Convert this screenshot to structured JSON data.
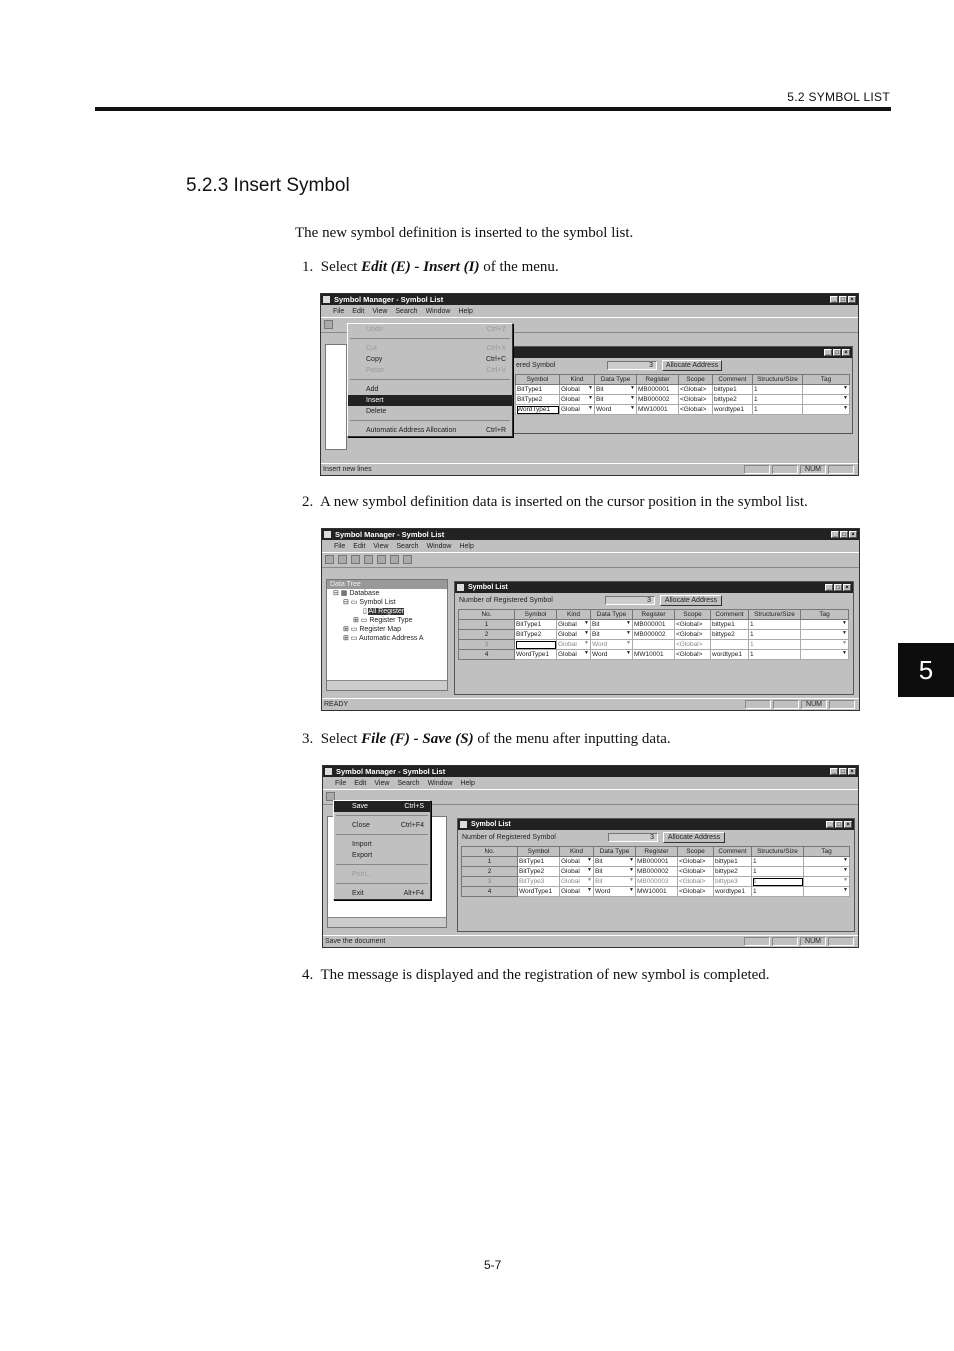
{
  "header": {
    "section": "5.2  SYMBOL LIST"
  },
  "section_title": "5.2.3  Insert Symbol",
  "intro": "The new symbol definition is inserted to the symbol list.",
  "steps": [
    {
      "num": "1.",
      "pre": "Select ",
      "bold": "Edit (E) - Insert (I)",
      "post": " of the menu."
    },
    {
      "num": "2.",
      "text": "A new symbol definition data is inserted on the cursor position in the symbol list."
    },
    {
      "num": "3.",
      "pre": "Select ",
      "bold": "File (F) - Save (S)",
      "post": " of the menu after inputting data."
    },
    {
      "num": "4.",
      "text": "The message is displayed and the registration of new symbol is completed."
    }
  ],
  "chapter_tab": "5",
  "page_number": "5-7",
  "app": {
    "title": "Symbol Manager - Symbol List",
    "menubar": [
      "File",
      "Edit",
      "View",
      "Search",
      "Window",
      "Help"
    ],
    "child_title": "Symbol List",
    "registered_label": "Number of Registered Symbol",
    "registered_label_short": "ered Symbol",
    "registered_value": "3",
    "alloc_button": "Allocate Address",
    "columns": [
      "No.",
      "Symbol",
      "Kind",
      "Data Type",
      "Register",
      "Scope",
      "Comment",
      "Structure/Size",
      "Tag"
    ],
    "tree_title": "Data Tree",
    "tree": [
      "Database",
      "Symbol List",
      "All Register",
      "Register Type",
      "Register Map",
      "Automatic Address A"
    ],
    "status_num": "NUM"
  },
  "shot1": {
    "status": "Insert new lines",
    "menu": [
      {
        "label": "Undo",
        "shortcut": "Ctrl+Z",
        "disabled": true
      },
      {
        "sep": true
      },
      {
        "label": "Cut",
        "shortcut": "Ctrl+X",
        "disabled": true
      },
      {
        "label": "Copy",
        "shortcut": "Ctrl+C",
        "disabled": false
      },
      {
        "label": "Paste",
        "shortcut": "Ctrl+V",
        "disabled": true
      },
      {
        "sep": true
      },
      {
        "label": "Add",
        "shortcut": "",
        "disabled": false
      },
      {
        "label": "Insert",
        "shortcut": "",
        "disabled": false,
        "highlight": true
      },
      {
        "label": "Delete",
        "shortcut": "",
        "disabled": false
      },
      {
        "sep": true
      },
      {
        "label": "Automatic Address Allocation",
        "shortcut": "Ctrl+R",
        "disabled": false
      }
    ],
    "rows": [
      [
        "BitType1",
        "Global",
        "Bit",
        "MB000001",
        "<Global>",
        "bittype1",
        "1",
        ""
      ],
      [
        "BitType2",
        "Global",
        "Bit",
        "MB000002",
        "<Global>",
        "bittype2",
        "1",
        ""
      ],
      [
        "WordType1",
        "Global",
        "Word",
        "MW10001",
        "<Global>",
        "wordtype1",
        "1",
        ""
      ]
    ]
  },
  "shot2": {
    "status": "READY",
    "rows": [
      [
        "1",
        "BitType1",
        "Global",
        "Bit",
        "MB000001",
        "<Global>",
        "bittype1",
        "1",
        ""
      ],
      [
        "2",
        "BitType2",
        "Global",
        "Bit",
        "MB000002",
        "<Global>",
        "bittype2",
        "1",
        ""
      ],
      [
        "3",
        "",
        "Global",
        "Word",
        "",
        "<Global>",
        "",
        "1",
        ""
      ],
      [
        "4",
        "WordType1",
        "Global",
        "Word",
        "MW10001",
        "<Global>",
        "wordtype1",
        "1",
        ""
      ]
    ]
  },
  "shot3": {
    "status": "Save the document",
    "menu": [
      {
        "label": "Save",
        "shortcut": "Ctrl+S",
        "disabled": false,
        "highlight": true
      },
      {
        "sep": true
      },
      {
        "label": "Close",
        "shortcut": "Ctrl+F4",
        "disabled": false
      },
      {
        "sep": true
      },
      {
        "label": "Import",
        "shortcut": "",
        "disabled": false
      },
      {
        "label": "Export",
        "shortcut": "",
        "disabled": false
      },
      {
        "sep": true
      },
      {
        "label": "Print...",
        "shortcut": "",
        "disabled": true
      },
      {
        "sep": true
      },
      {
        "label": "Exit",
        "shortcut": "Alt+F4",
        "disabled": false
      }
    ],
    "rows": [
      [
        "1",
        "BitType1",
        "Global",
        "Bit",
        "MB000001",
        "<Global>",
        "bittype1",
        "1",
        ""
      ],
      [
        "2",
        "BitType2",
        "Global",
        "Bit",
        "MB000002",
        "<Global>",
        "bittype2",
        "1",
        ""
      ],
      [
        "3",
        "BitType3",
        "Global",
        "Bit",
        "MB000003",
        "<Global>",
        "bittype3",
        "1",
        ""
      ],
      [
        "4",
        "WordType1",
        "Global",
        "Word",
        "MW10001",
        "<Global>",
        "wordtype1",
        "1",
        ""
      ]
    ]
  }
}
